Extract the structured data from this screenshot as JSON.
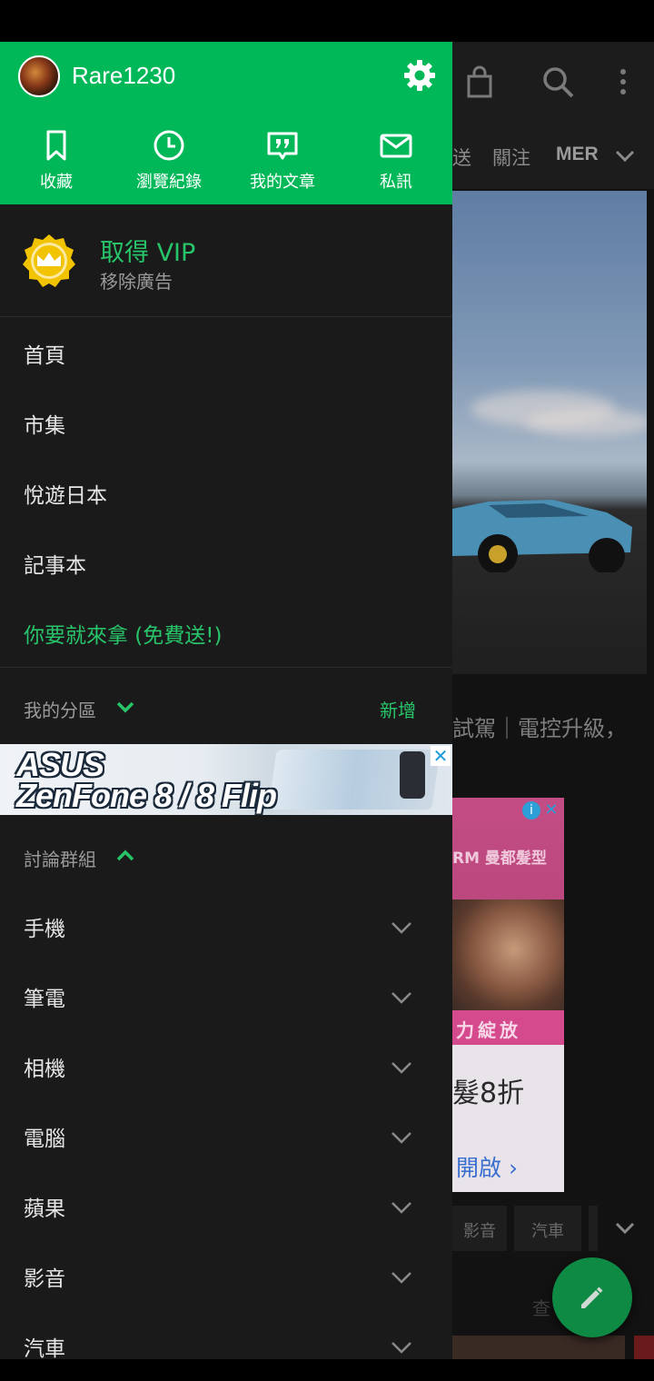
{
  "drawer": {
    "username": "Rare1230",
    "quick_actions": [
      {
        "label": "收藏",
        "icon": "bookmark-icon"
      },
      {
        "label": "瀏覽紀錄",
        "icon": "clock-icon"
      },
      {
        "label": "我的文章",
        "icon": "quote-article-icon"
      },
      {
        "label": "私訊",
        "icon": "mail-icon"
      }
    ],
    "vip": {
      "title": "取得 VIP",
      "subtitle": "移除廣告"
    },
    "menu": [
      "首頁",
      "市集",
      "悅遊日本",
      "記事本"
    ],
    "promo": "你要就來拿 (免費送!)",
    "my_sections": {
      "label": "我的分區",
      "add": "新增"
    },
    "ad": {
      "line1": "ASUS",
      "line2": "ZenFone 8 / 8 Flip",
      "close": "✕"
    },
    "groups": {
      "label": "討論群組",
      "items": [
        "手機",
        "筆電",
        "相機",
        "電腦",
        "蘋果",
        "影音",
        "汽車"
      ]
    }
  },
  "background": {
    "tabs": [
      "送",
      "關注",
      "MER"
    ],
    "headline": "試駕｜電控升級，",
    "ad": {
      "brand": "RM 曼都髮型",
      "band": "力綻放",
      "price": "髮8折",
      "open": "開啟 ›",
      "info": "i",
      "close": "✕"
    },
    "chips": [
      "影音",
      "汽車"
    ],
    "link": "查"
  },
  "colors": {
    "accent": "#00b858",
    "accent_text": "#28c46a",
    "drawer_bg": "#1a1a1a",
    "fab": "#0e8a44"
  }
}
